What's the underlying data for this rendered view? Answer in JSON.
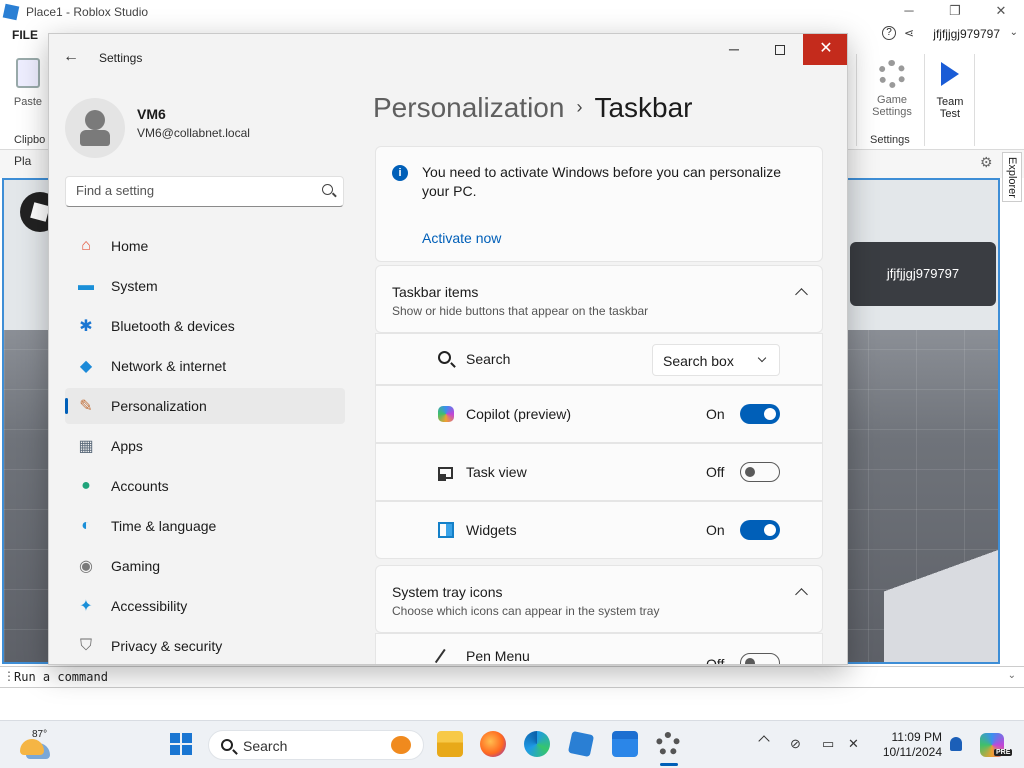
{
  "roblox": {
    "title": "Place1 - Roblox Studio",
    "window_controls": {
      "minimize": "─",
      "restore": "❐",
      "close": "✕"
    },
    "menu_file": "FILE",
    "help_icon": "?",
    "user": "jfjfjjgj979797",
    "ribbon": {
      "paste_label": "Paste",
      "clipboard_group": "Clipbo",
      "game_settings_label": "Game Settings",
      "settings_group": "Settings",
      "team_test_label": "Team Test"
    },
    "place_tab": "Pla",
    "explorer_tab": "Explorer",
    "viewport_username": "jfjfjjgj979797",
    "command_placeholder": "Run a command",
    "command_dots": "⋮",
    "dropdown_chevron": "⌄"
  },
  "settings": {
    "app_title": "Settings",
    "back_icon": "←",
    "window_controls": {
      "minimize": "─",
      "close": "✕"
    },
    "profile": {
      "name": "VM6",
      "email": "VM6@collabnet.local"
    },
    "search_placeholder": "Find a setting",
    "nav": [
      {
        "label": "Home",
        "icon": "home-icon",
        "glyph": "⌂",
        "color": "#e4573d"
      },
      {
        "label": "System",
        "icon": "system-icon",
        "glyph": "▬",
        "color": "#1a8fd8"
      },
      {
        "label": "Bluetooth & devices",
        "icon": "bluetooth-icon",
        "glyph": "✱",
        "color": "#1a76d2"
      },
      {
        "label": "Network & internet",
        "icon": "network-icon",
        "glyph": "◆",
        "color": "#1c8ad8"
      },
      {
        "label": "Personalization",
        "icon": "brush-icon",
        "glyph": "✎",
        "color": "#c2703a",
        "active": true
      },
      {
        "label": "Apps",
        "icon": "apps-icon",
        "glyph": "▦",
        "color": "#5b6a7a"
      },
      {
        "label": "Accounts",
        "icon": "accounts-icon",
        "glyph": "●",
        "color": "#1fa37a"
      },
      {
        "label": "Time & language",
        "icon": "globe-icon",
        "glyph": "◐",
        "color": "#1a8fd8"
      },
      {
        "label": "Gaming",
        "icon": "gamepad-icon",
        "glyph": "◉",
        "color": "#7a7a7a"
      },
      {
        "label": "Accessibility",
        "icon": "accessibility-icon",
        "glyph": "✦",
        "color": "#1a8fd8"
      },
      {
        "label": "Privacy & security",
        "icon": "shield-icon",
        "glyph": "⛉",
        "color": "#6b6b6b"
      }
    ],
    "breadcrumb": {
      "parent": "Personalization",
      "separator": "›",
      "current": "Taskbar"
    },
    "activation": {
      "message": "You need to activate Windows before you can personalize your PC.",
      "link": "Activate now"
    },
    "taskbar_items": {
      "title": "Taskbar items",
      "subtitle": "Show or hide buttons that appear on the taskbar",
      "search_label": "Search",
      "search_value": "Search box",
      "items": [
        {
          "label": "Copilot (preview)",
          "state": "On",
          "on": true
        },
        {
          "label": "Task view",
          "state": "Off",
          "on": false
        },
        {
          "label": "Widgets",
          "state": "On",
          "on": true
        }
      ]
    },
    "system_tray": {
      "title": "System tray icons",
      "subtitle": "Choose which icons can appear in the system tray",
      "pen_label": "Pen Menu",
      "pen_state": "Off"
    }
  },
  "taskbar": {
    "weather_temp": "87°",
    "search_label": "Search",
    "time": "11:09 PM",
    "date": "10/11/2024",
    "copilot_badge": "PRE"
  },
  "colors": {
    "accent": "#005fb8",
    "close_red": "#c42b1c"
  }
}
